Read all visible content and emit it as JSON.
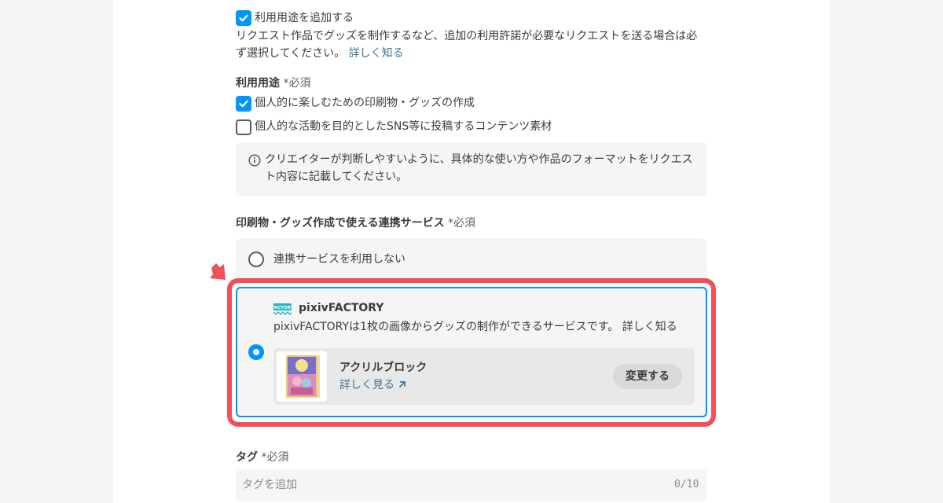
{
  "usage_toggle": {
    "label": "利用用途を追加する",
    "checked": true,
    "desc_line1": "リクエスト作品でグッズを制作するなど、追加の利用許諾が必要なリクエストを送る場合は必",
    "desc_line2": "ず選択してください。",
    "learn_more": "詳しく知る"
  },
  "usage": {
    "title": "利用用途",
    "required": "*必須",
    "options": [
      {
        "label": "個人的に楽しむための印刷物・グッズの作成",
        "checked": true
      },
      {
        "label": "個人的な活動を目的としたSNS等に投稿するコンテンツ素材",
        "checked": false
      }
    ],
    "notice_line1": "クリエイターが判断しやすいように、具体的な使い方や作品のフォーマットをリクエス",
    "notice_line2": "ト内容に記載してください。"
  },
  "service": {
    "title": "印刷物・グッズ作成で使える連携サービス",
    "required": "*必須",
    "option_none": "連携サービスを利用しない",
    "factory": {
      "name": "pixivFACTORY",
      "logo_text": "FACTORY",
      "description": "pixivFACTORYは1枚の画像からグッズの制作ができるサービスです。",
      "learn_more": "詳しく知る",
      "selected": true,
      "product": {
        "name": "アクリルブロック",
        "details_link": "詳しく見る",
        "change_button": "変更する"
      }
    }
  },
  "tags": {
    "title": "タグ",
    "required": "*必須",
    "placeholder": "タグを追加",
    "counter": "0/10"
  },
  "colors": {
    "accent": "#0096fa",
    "highlight": "#f0505a",
    "link": "#3d7699"
  }
}
